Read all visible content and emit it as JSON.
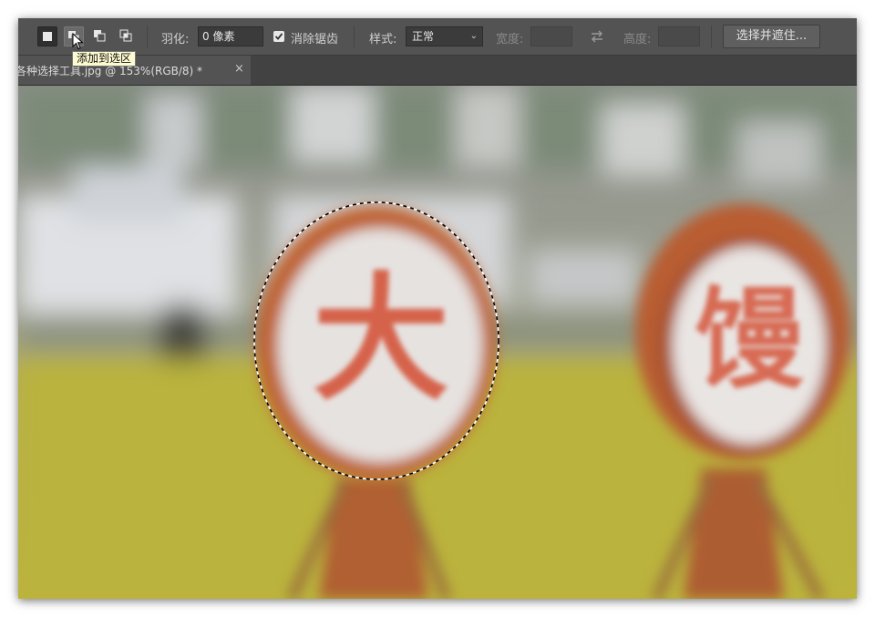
{
  "options_bar": {
    "selection_modes": [
      {
        "name": "new-selection",
        "icon": "new-selection-icon"
      },
      {
        "name": "add-to-selection",
        "icon": "add-to-selection-icon"
      },
      {
        "name": "subtract-from-selection",
        "icon": "subtract-from-selection-icon"
      },
      {
        "name": "intersect-with-selection",
        "icon": "intersect-selection-icon"
      }
    ],
    "feather_label": "羽化:",
    "feather_value": "0 像素",
    "antialias_label": "消除锯齿",
    "antialias_checked": true,
    "style_label": "样式:",
    "style_value": "正常",
    "width_label": "宽度:",
    "height_label": "高度:",
    "select_mask_button": "选择并遮住..."
  },
  "tooltip": "添加到选区",
  "document_tab": {
    "title": "各种选择工具.jpg @ 153%(RGB/8) *",
    "close": "×"
  },
  "canvas": {
    "left_sign_char": "大",
    "right_sign_char": "馒",
    "selection": "elliptical-marquee"
  },
  "colors": {
    "panel": "#535353",
    "tab_bar": "#424242",
    "sign_red": "#d4553a",
    "sign_ring": "#b85a30",
    "field_yellow": "#b9b23e"
  }
}
